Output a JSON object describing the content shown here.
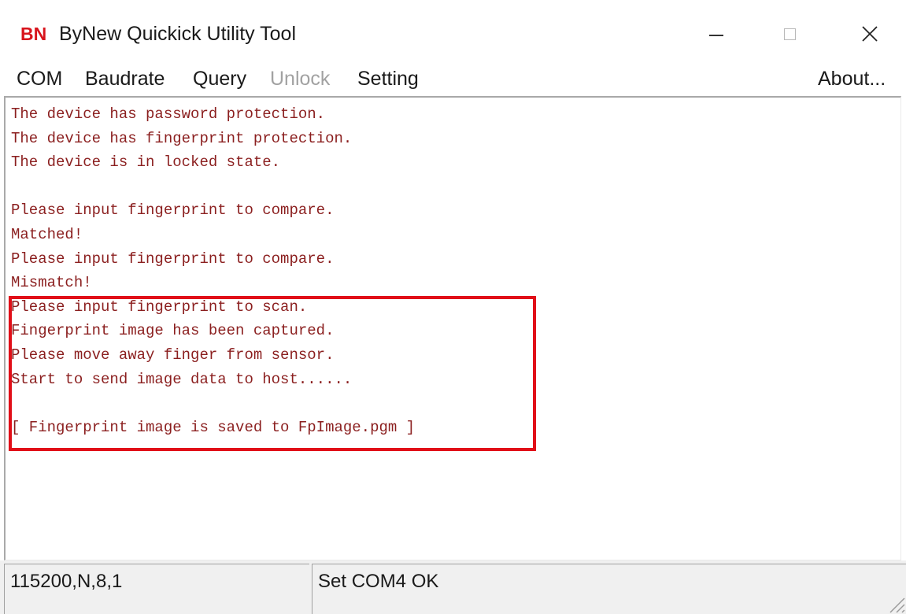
{
  "window": {
    "logo": "BN",
    "title": "ByNew Quickick Utility Tool",
    "controls": {
      "minimize_icon": "minimize-icon",
      "maximize_icon": "maximize-icon",
      "close_icon": "close-icon",
      "close_glyph": "✕"
    }
  },
  "menu": {
    "com": "COM",
    "baudrate": "Baudrate",
    "query": "Query",
    "unlock": "Unlock",
    "setting": "Setting",
    "about": "About..."
  },
  "log": {
    "lines": [
      "The device has password protection.",
      "The device has fingerprint protection.",
      "The device is in locked state.",
      "",
      "Please input fingerprint to compare.",
      "Matched!",
      "Please input fingerprint to compare.",
      "Mismatch!",
      "Please input fingerprint to scan.",
      "Fingerprint image has been captured.",
      "Please move away finger from sensor.",
      "Start to send image data to host......",
      "",
      "[ Fingerprint image is saved to FpImage.pgm ]"
    ]
  },
  "status": {
    "serial_config": "115200,N,8,1",
    "message": "Set COM4 OK"
  },
  "colors": {
    "logo": "#d8141c",
    "log_text": "#8b1f1f",
    "highlight": "#e10f18",
    "disabled_menu": "#a2a2a2"
  }
}
